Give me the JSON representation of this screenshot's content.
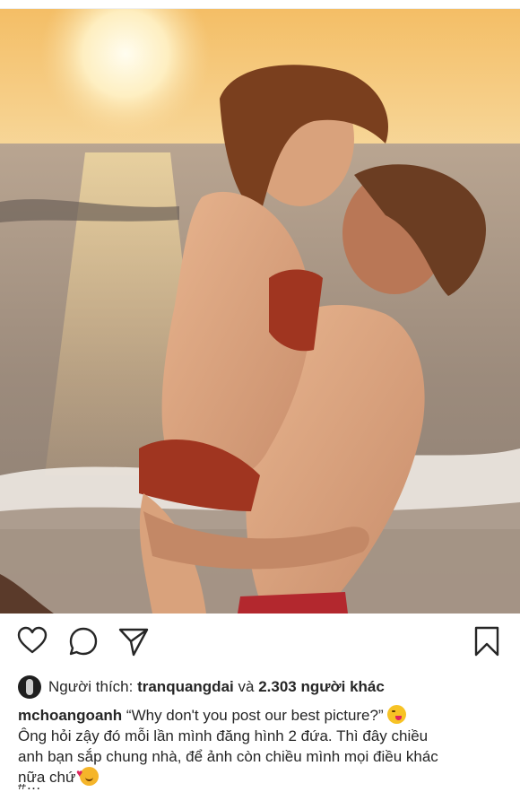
{
  "post": {
    "likes": {
      "prefix": "Người thích:",
      "user": "tranquangdai",
      "connector": "và",
      "others": "2.303 người khác"
    },
    "caption": {
      "username": "mchoangoanh",
      "quote": "“Why don't you post our best picture?”",
      "line2": "Ông hỏi zậy đó mỗi lần mình đăng hình 2 đứa. Thì đây chiều",
      "line3": "anh bạn sắp chung nhà, để ảnh còn chiều mình mọi điều khác",
      "line4": "nữa chứ",
      "partial_line": "#..."
    },
    "icons": {
      "like": "heart-icon",
      "comment": "comment-icon",
      "share": "share-icon",
      "save": "bookmark-icon"
    }
  },
  "colors": {
    "text": "#262626",
    "sky_top": "#f2b860",
    "sun": "#fff6d8",
    "sea": "#9a8c80"
  }
}
